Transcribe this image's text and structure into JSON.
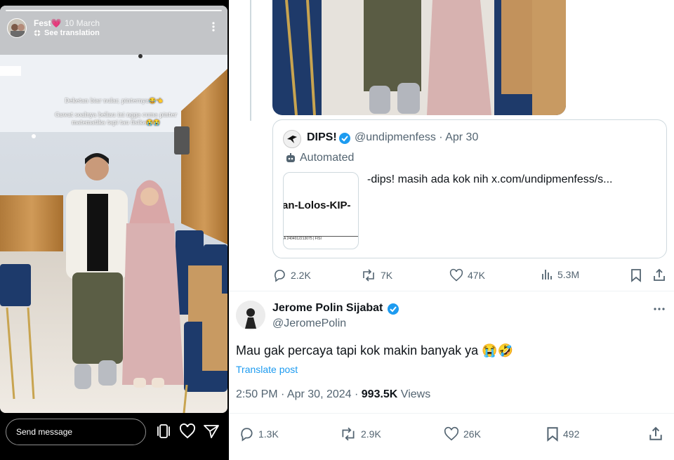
{
  "story": {
    "username": "Fest💗",
    "date": "10 March",
    "see_translation": "See translation",
    "overlay_line1": "Deketan biar nular, pinternya😂👈",
    "overlay_line2": "Gawat soalnya beliau ini ngga cuma pinter matematika tapi tau fisika😭😭",
    "message_placeholder": "Send message"
  },
  "quote": {
    "name": "DIPS!",
    "handle_date": "@undipmenfess · Apr 30",
    "automated": "Automated",
    "text": "-dips!  masih ada kok nih  x.com/undipmenfess/s...",
    "thumb_text": "an-Lolos-KIP-",
    "thumb_row": "A      2404012213075 | FISI"
  },
  "quote_actions": {
    "replies": "2.2K",
    "reposts": "7K",
    "likes": "47K",
    "views": "5.3M"
  },
  "post": {
    "author_name": "Jerome Polin Sijabat",
    "author_handle": "@JeromePolin",
    "text": "Mau gak percaya tapi kok makin banyak ya 😭🤣",
    "translate": "Translate post",
    "time_date": "2:50 PM · Apr 30, 2024 · ",
    "views_count": "993.5K",
    "views_label": " Views"
  },
  "post_actions": {
    "replies": "1.3K",
    "reposts": "2.9K",
    "likes": "26K",
    "bookmarks": "492"
  },
  "colors": {
    "verified": "#1d9bf0",
    "muted": "#536471",
    "text": "#0f1419"
  }
}
